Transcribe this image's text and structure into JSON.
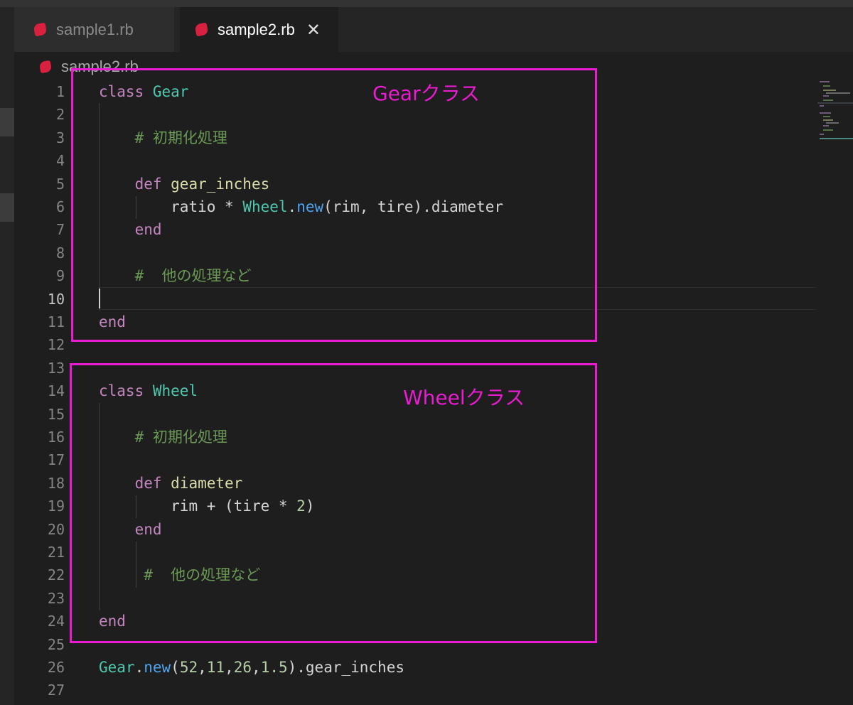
{
  "tabs": [
    {
      "label": "sample1.rb",
      "active": false,
      "icon": "ruby-icon"
    },
    {
      "label": "sample2.rb",
      "active": true,
      "icon": "ruby-icon",
      "close_glyph": "✕"
    }
  ],
  "breadcrumb": {
    "file": "sample2.rb",
    "icon": "ruby-icon"
  },
  "active_line": 10,
  "lines": [
    {
      "n": "1",
      "tokens": [
        {
          "t": "class ",
          "k": "kw"
        },
        {
          "t": "Gear",
          "k": "cls"
        }
      ]
    },
    {
      "n": "2",
      "tokens": []
    },
    {
      "n": "3",
      "tokens": [
        {
          "t": "    "
        },
        {
          "t": "# 初期化処理",
          "k": "cmt"
        }
      ]
    },
    {
      "n": "4",
      "tokens": []
    },
    {
      "n": "5",
      "tokens": [
        {
          "t": "    "
        },
        {
          "t": "def ",
          "k": "kw"
        },
        {
          "t": "gear_inches",
          "k": "fn"
        }
      ]
    },
    {
      "n": "6",
      "tokens": [
        {
          "t": "        "
        },
        {
          "t": "ratio * ",
          "k": "var"
        },
        {
          "t": "Wheel",
          "k": "cls"
        },
        {
          "t": ".",
          "k": "var"
        },
        {
          "t": "new",
          "k": "mth"
        },
        {
          "t": "(rim, tire).diameter",
          "k": "var"
        }
      ]
    },
    {
      "n": "7",
      "tokens": [
        {
          "t": "    "
        },
        {
          "t": "end",
          "k": "kw"
        }
      ]
    },
    {
      "n": "8",
      "tokens": []
    },
    {
      "n": "9",
      "tokens": [
        {
          "t": "    "
        },
        {
          "t": "#  他の処理など",
          "k": "cmt"
        }
      ]
    },
    {
      "n": "10",
      "tokens": []
    },
    {
      "n": "11",
      "tokens": [
        {
          "t": "end",
          "k": "kw"
        }
      ]
    },
    {
      "n": "12",
      "tokens": []
    },
    {
      "n": "13",
      "tokens": []
    },
    {
      "n": "14",
      "tokens": [
        {
          "t": "class ",
          "k": "kw"
        },
        {
          "t": "Wheel",
          "k": "cls"
        }
      ]
    },
    {
      "n": "15",
      "tokens": []
    },
    {
      "n": "16",
      "tokens": [
        {
          "t": "    "
        },
        {
          "t": "# 初期化処理",
          "k": "cmt"
        }
      ]
    },
    {
      "n": "17",
      "tokens": []
    },
    {
      "n": "18",
      "tokens": [
        {
          "t": "    "
        },
        {
          "t": "def ",
          "k": "kw"
        },
        {
          "t": "diameter",
          "k": "fn"
        }
      ]
    },
    {
      "n": "19",
      "tokens": [
        {
          "t": "        "
        },
        {
          "t": "rim + (tire * ",
          "k": "var"
        },
        {
          "t": "2",
          "k": "numv"
        },
        {
          "t": ")",
          "k": "var"
        }
      ]
    },
    {
      "n": "20",
      "tokens": [
        {
          "t": "    "
        },
        {
          "t": "end",
          "k": "kw"
        }
      ]
    },
    {
      "n": "21",
      "tokens": []
    },
    {
      "n": "22",
      "tokens": [
        {
          "t": "     "
        },
        {
          "t": "#  他の処理など",
          "k": "cmt"
        }
      ]
    },
    {
      "n": "23",
      "tokens": []
    },
    {
      "n": "24",
      "tokens": [
        {
          "t": "end",
          "k": "kw"
        }
      ]
    },
    {
      "n": "25",
      "tokens": []
    },
    {
      "n": "26",
      "tokens": [
        {
          "t": "Gear",
          "k": "cls"
        },
        {
          "t": ".",
          "k": "var"
        },
        {
          "t": "new",
          "k": "mth"
        },
        {
          "t": "(",
          "k": "var"
        },
        {
          "t": "52",
          "k": "numv"
        },
        {
          "t": ",",
          "k": "var"
        },
        {
          "t": "11",
          "k": "numv"
        },
        {
          "t": ",",
          "k": "var"
        },
        {
          "t": "26",
          "k": "numv"
        },
        {
          "t": ",",
          "k": "var"
        },
        {
          "t": "1.5",
          "k": "numv"
        },
        {
          "t": ").gear_inches",
          "k": "var"
        }
      ]
    },
    {
      "n": "27",
      "tokens": []
    }
  ],
  "annotations": [
    {
      "label": "Gearクラス"
    },
    {
      "label": "Wheelクラス"
    }
  ],
  "colors": {
    "annotation": "#ea1bd0",
    "keyword": "#c586c0",
    "class": "#4ec9b0",
    "function": "#dcdcaa",
    "method": "#4fa4f0",
    "number": "#b5cea8",
    "comment": "#6a9955",
    "ruby_icon": "#d8213e"
  }
}
